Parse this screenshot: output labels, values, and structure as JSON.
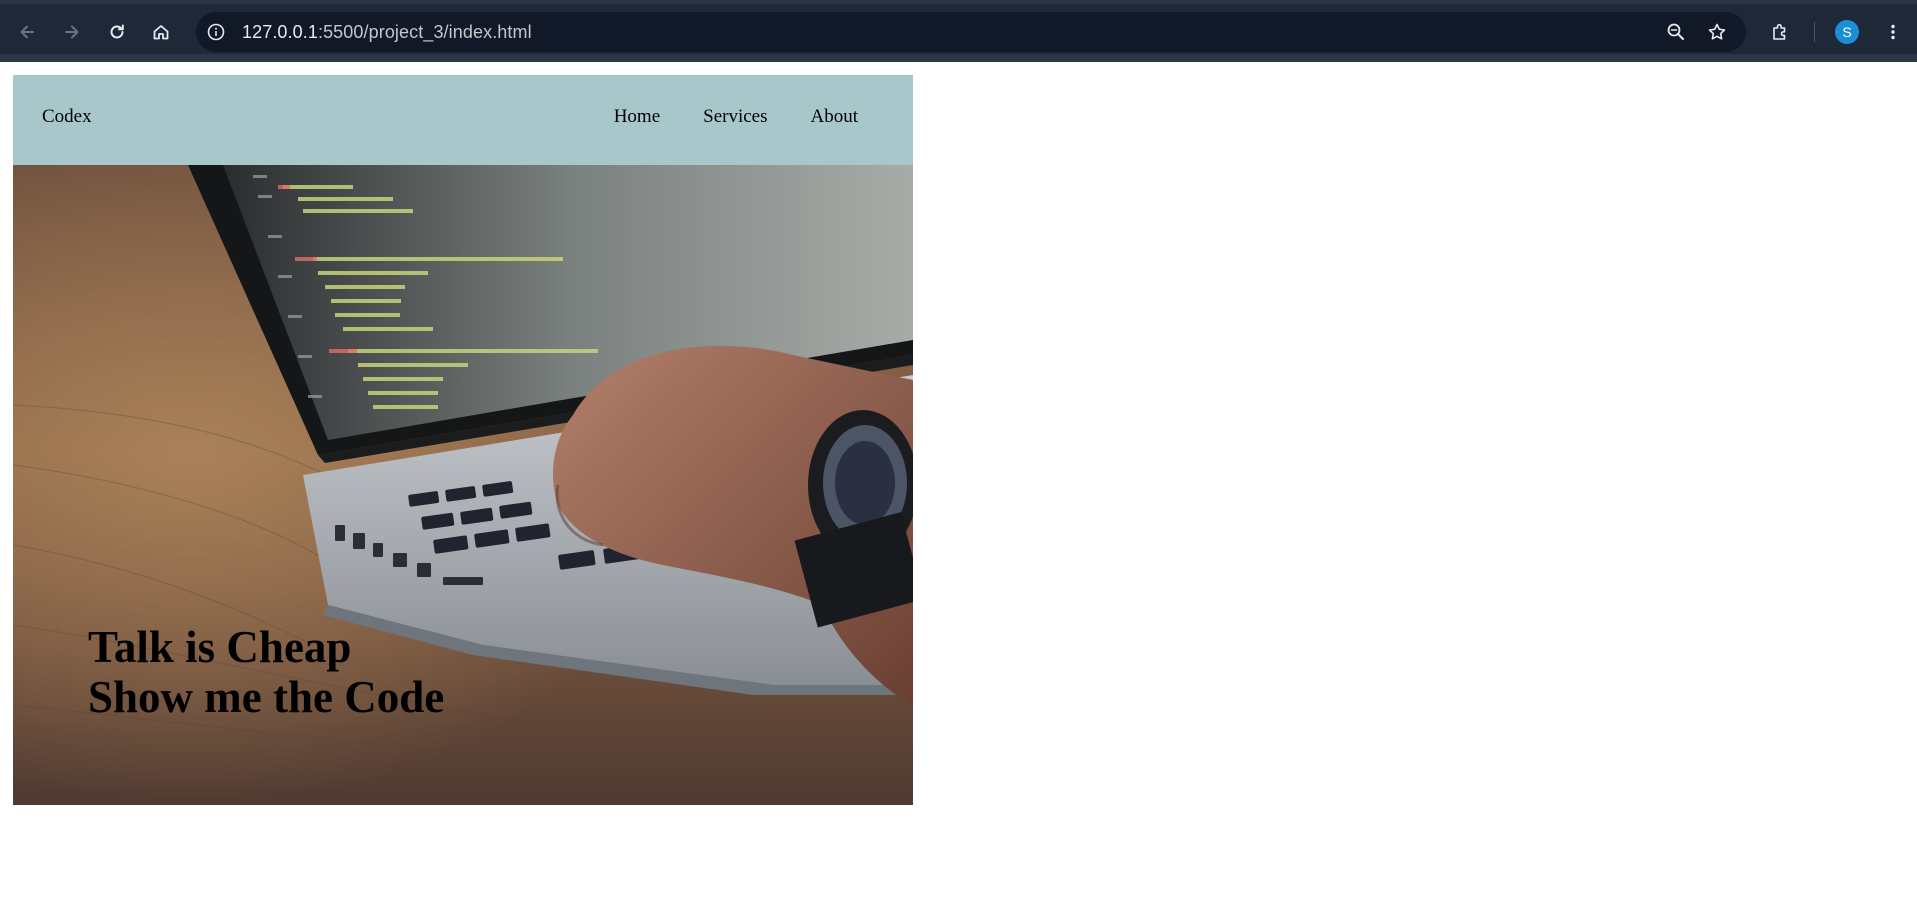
{
  "browser": {
    "url_host": "127.0.0.1",
    "url_path": ":5500/project_3/index.html",
    "profile_initial": "S",
    "icons": [
      "back-arrow-icon",
      "forward-arrow-icon",
      "reload-icon",
      "home-icon",
      "site-info-icon",
      "zoom-icon",
      "bookmark-star-icon",
      "extensions-icon",
      "menu-kebab-icon"
    ],
    "colors": {
      "toolbar": "#1f2838",
      "omnibox": "#111827",
      "avatar": "#1a8fd6"
    }
  },
  "page": {
    "brand": "Codex",
    "nav": [
      {
        "label": "Home"
      },
      {
        "label": "Services"
      },
      {
        "label": "About"
      }
    ],
    "hero": {
      "line1": "Talk is Cheap",
      "line2": "Show me the Code"
    },
    "colors": {
      "header_bg": "#a8c7cb"
    }
  }
}
